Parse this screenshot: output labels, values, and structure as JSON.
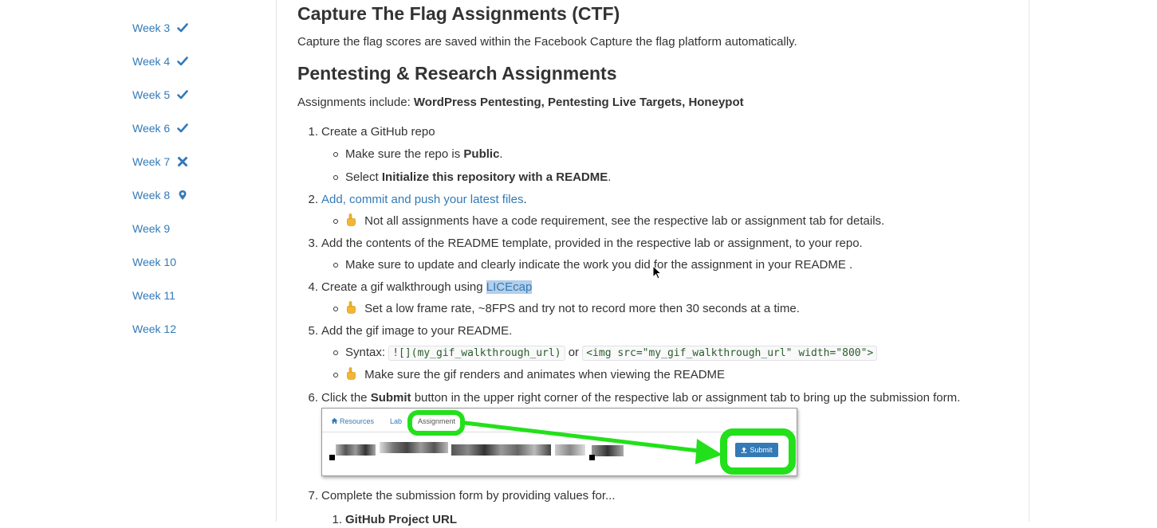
{
  "sidebar": {
    "weeks": [
      {
        "label": "Week 3",
        "icon": "check-icon"
      },
      {
        "label": "Week 4",
        "icon": "check-icon"
      },
      {
        "label": "Week 5",
        "icon": "check-icon"
      },
      {
        "label": "Week 6",
        "icon": "check-icon"
      },
      {
        "label": "Week 7",
        "icon": "x-icon"
      },
      {
        "label": "Week 8",
        "icon": "map-marker-icon"
      },
      {
        "label": "Week 9",
        "icon": ""
      },
      {
        "label": "Week 10",
        "icon": ""
      },
      {
        "label": "Week 11",
        "icon": ""
      },
      {
        "label": "Week 12",
        "icon": ""
      }
    ]
  },
  "main": {
    "ctf_heading": "Capture The Flag Assignments (CTF)",
    "ctf_text": "Capture the flag scores are saved within the Facebook Capture the flag platform automatically.",
    "pentest_heading": "Pentesting & Research Assignments",
    "includes_prefix": "Assignments include: ",
    "includes_bold": "WordPress Pentesting, Pentesting Live Targets, Honeypot",
    "steps": {
      "s1_num": "1.",
      "s1_link": "Create a GitHub repo",
      "s1_b1_pre": "Make sure the repo is ",
      "s1_b1_bold": "Public",
      "s1_b1_post": ".",
      "s1_b2_pre": "Select ",
      "s1_b2_bold": "Initialize this repository with a README",
      "s1_b2_post": ".",
      "s2_num": "2.",
      "s2_link": "Add, commit and push your latest files",
      "s2_post": ".",
      "s2_b1": "Not all assignments have a code requirement, see the respective lab or assignment tab for details.",
      "s3_num": "3.",
      "s3_text": "Add the contents of the README template, provided in the respective lab or assignment, to your repo.",
      "s3_b1": "Make sure to update and clearly indicate the work you did for the assignment in your README .",
      "s4_num": "4.",
      "s4_pre": "Create a gif walkthrough using ",
      "s4_link": "LICEcap",
      "s4_b1": "Set a low frame rate, ~8FPS and try not to record more then 30 seconds at a time.",
      "s5_num": "5.",
      "s5_text": "Add the gif image to your README.",
      "s5_b1_pre": "Syntax: ",
      "s5_code1": "![](my_gif_walkthrough_url)",
      "s5_or": " or ",
      "s5_code2": "<img src=\"my_gif_walkthrough_url\" width=\"800\">",
      "s5_b2": "Make sure the gif renders and animates when viewing the README",
      "s6_num": "6.",
      "s6_pre": "Click the ",
      "s6_bold": "Submit",
      "s6_post": " button in the upper right corner of the respective lab or assignment tab to bring up the submission form.",
      "s7_num": "7.",
      "s7_text": "Complete the submission form by providing values for...",
      "s7_sub1_num": "1.",
      "s7_sub1_text": "GitHub Project URL"
    },
    "screenshot": {
      "tab_resources": "Resources",
      "tab_lab": "Lab",
      "tab_assignment": "Assignment",
      "submit_label": "Submit"
    }
  },
  "colors": {
    "link": "#337ab7",
    "highlight_ring": "#22e01a",
    "text": "#333333"
  }
}
